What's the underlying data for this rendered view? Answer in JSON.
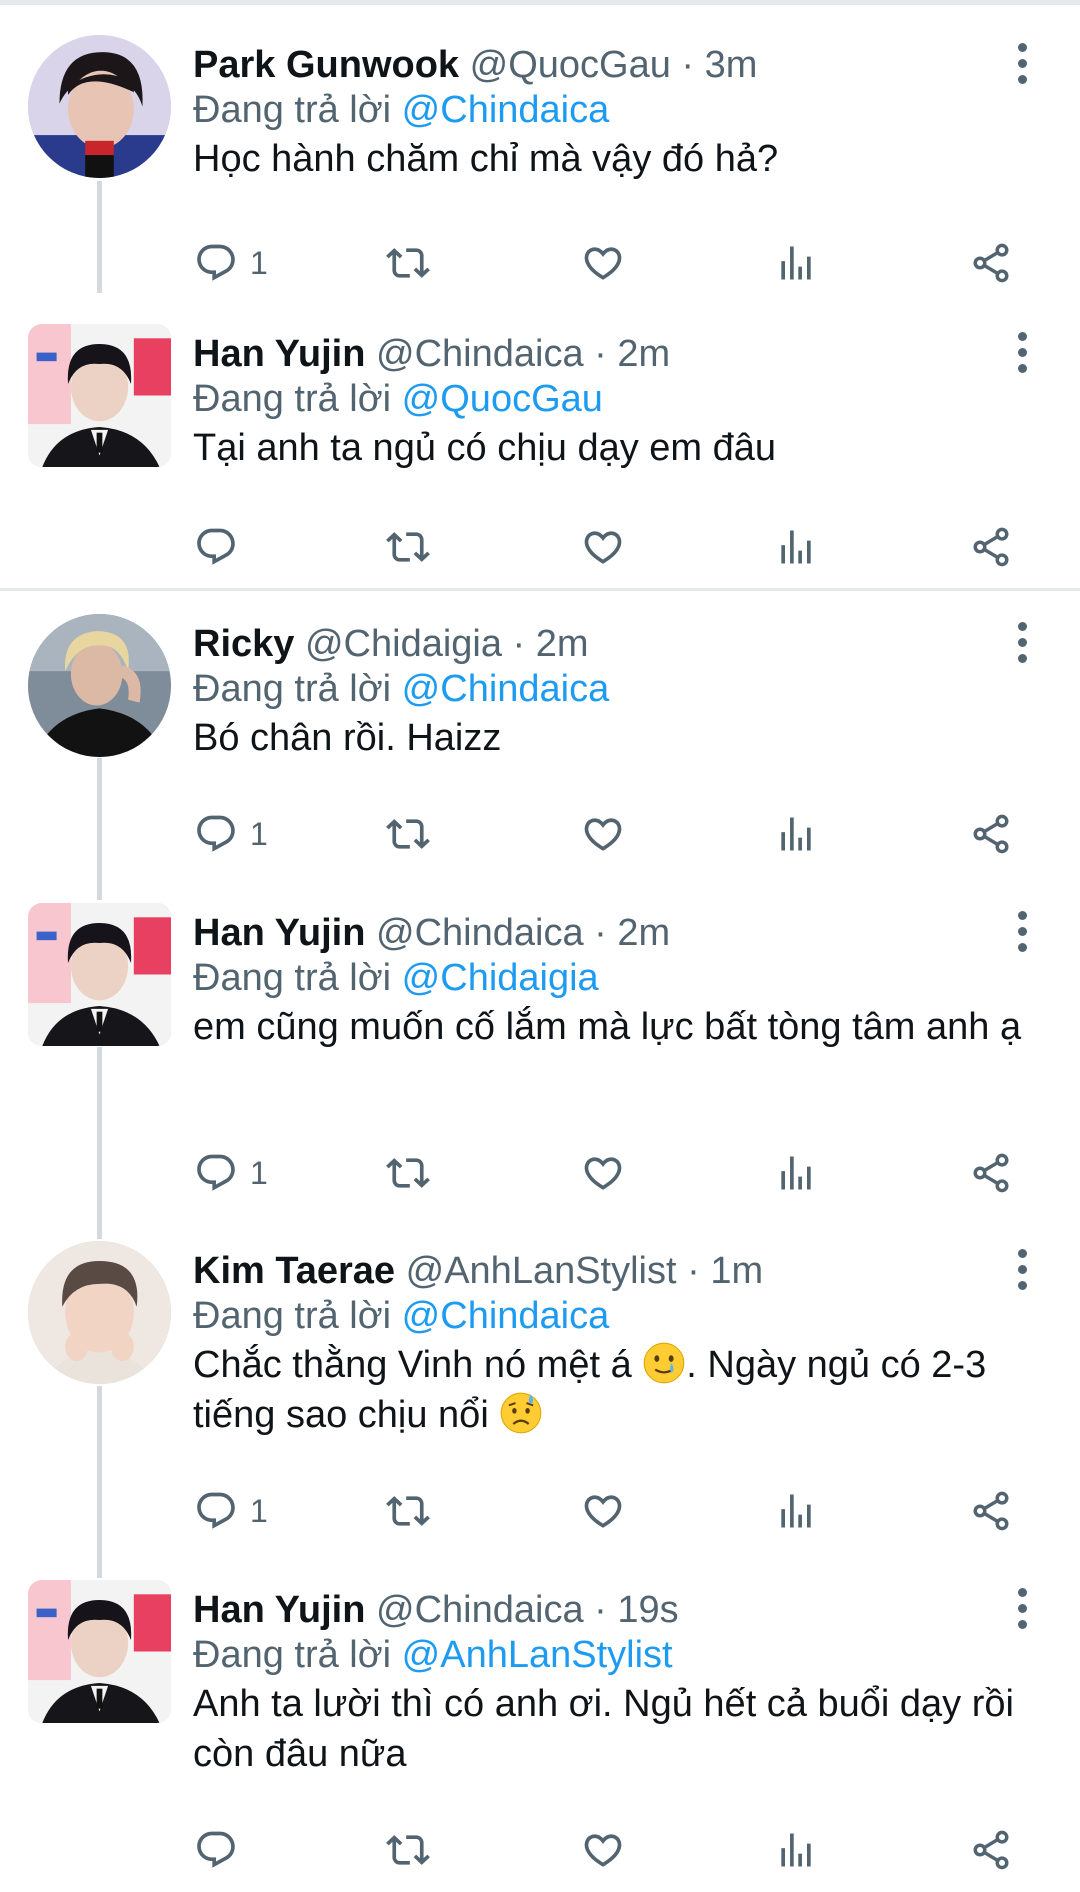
{
  "reply_prefix": "Đang trả lời",
  "separator": "·",
  "tweets": [
    {
      "name": "Park Gunwook",
      "handle": "@QuocGau",
      "time": "3m",
      "replying_to": "@Chindaica",
      "text": "Học hành chăm chỉ mà vậy đó hả?",
      "reply_count": "1",
      "avatar": "avatar-park-gunwook"
    },
    {
      "name": "Han Yujin",
      "handle": "@Chindaica",
      "time": "2m",
      "replying_to": "@QuocGau",
      "text": "Tại anh ta ngủ có chịu dạy em đâu",
      "reply_count": "",
      "avatar": "avatar-han-yujin"
    },
    {
      "name": "Ricky",
      "handle": "@Chidaigia",
      "time": "2m",
      "replying_to": "@Chindaica",
      "text": "Bó chân rồi. Haizz",
      "reply_count": "1",
      "avatar": "avatar-ricky"
    },
    {
      "name": "Han Yujin",
      "handle": "@Chindaica",
      "time": "2m",
      "replying_to": "@Chidaigia",
      "text": "em cũng muốn cố lắm mà lực bất tòng tâm anh ạ",
      "reply_count": "1",
      "avatar": "avatar-han-yujin"
    },
    {
      "name": "Kim Taerae",
      "handle": "@AnhLanStylist",
      "time": "1m",
      "replying_to": "@Chindaica",
      "text_part1": "Chắc thằng Vinh nó mệt á ",
      "emoji1": "smiling-face-with-tear-emoji",
      "text_part2": ". Ngày ngủ có 2-3 tiếng sao chịu nổi ",
      "emoji2": "sad-but-relieved-face-emoji",
      "reply_count": "1",
      "avatar": "avatar-kim-taerae"
    },
    {
      "name": "Han Yujin",
      "handle": "@Chindaica",
      "time": "19s",
      "replying_to": "@AnhLanStylist",
      "text": "Anh ta lười thì có anh ơi. Ngủ hết cả buổi dạy rồi còn đâu nữa",
      "reply_count": "",
      "avatar": "avatar-han-yujin"
    }
  ],
  "icons": [
    "reply-icon",
    "retweet-icon",
    "like-icon",
    "analytics-icon",
    "share-icon",
    "more-icon"
  ],
  "colors": {
    "mention": "#1d9bf0",
    "secondary_text": "#536471",
    "primary_text": "#0f1419",
    "thread_line": "#d4d9de",
    "separator": "#e6e9ec"
  }
}
